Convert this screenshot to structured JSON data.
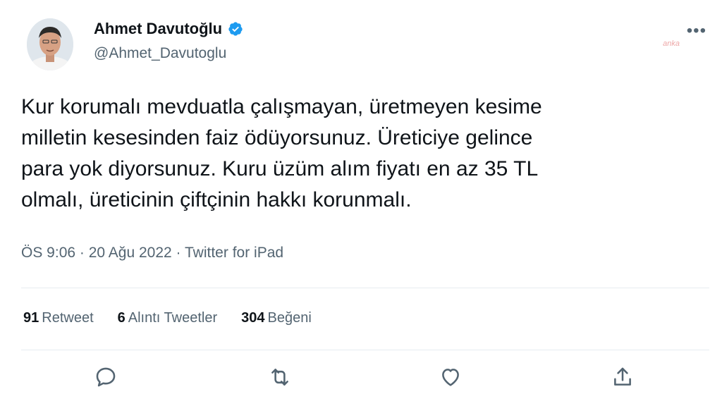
{
  "author": {
    "display_name": "Ahmet Davutoğlu",
    "handle": "@Ahmet_Davutoglu",
    "verified_icon": "verified-badge-icon"
  },
  "watermark": "anka",
  "tweet": {
    "text": "Kur korumalı mevduatla çalışmayan, üretmeyen kesime\nmilletin kesesinden faiz ödüyorsunuz. Üreticiye gelince\npara yok diyorsunuz. Kuru üzüm alım fiyatı en az 35 TL\nolmalı, üreticinin çiftçinin hakkı korunmalı."
  },
  "meta": {
    "time": "ÖS 9:06",
    "date": "20 Ağu 2022",
    "separator": "·",
    "source": "Twitter for iPad"
  },
  "stats": {
    "retweets": {
      "count": "91",
      "label": "Retweet"
    },
    "quotes": {
      "count": "6",
      "label": "Alıntı Tweetler"
    },
    "likes": {
      "count": "304",
      "label": "Beğeni"
    }
  },
  "colors": {
    "verified": "#1d9bf0",
    "secondary_text": "#536471",
    "icon": "#536471"
  },
  "icons": {
    "more": "more-horizontal-icon",
    "reply": "reply-icon",
    "retweet": "retweet-icon",
    "like": "heart-icon",
    "share": "share-icon"
  }
}
